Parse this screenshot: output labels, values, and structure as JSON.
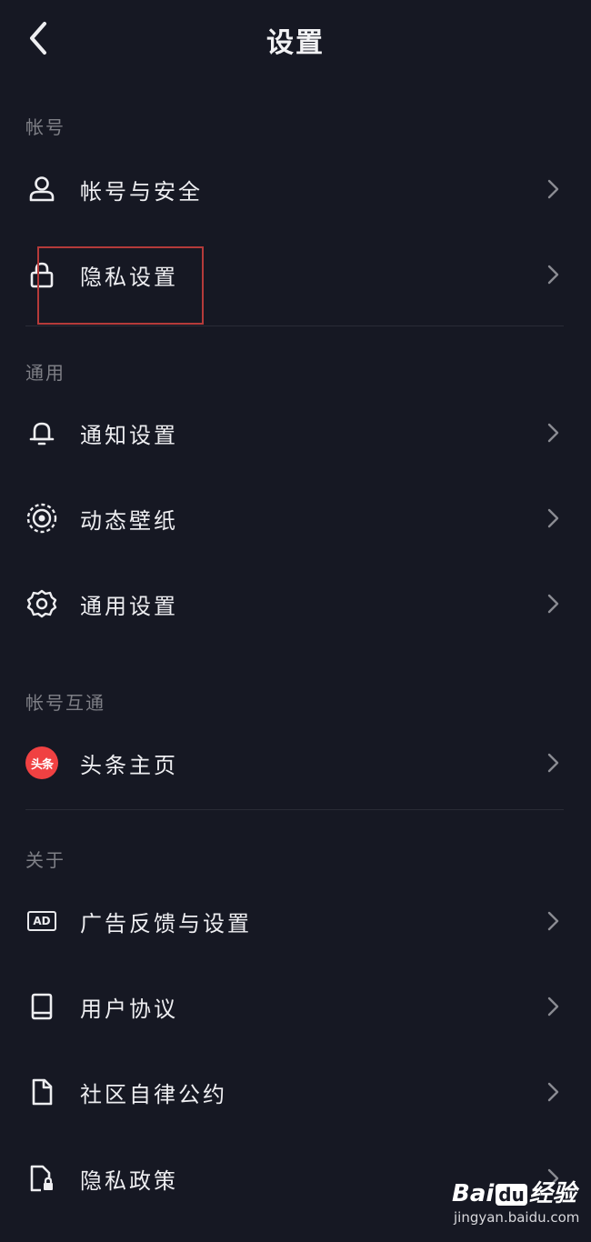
{
  "header": {
    "title": "设置"
  },
  "sections": {
    "account": "帐号",
    "general": "通用",
    "interop": "帐号互通",
    "about": "关于"
  },
  "items": {
    "account_security": "帐号与安全",
    "privacy_settings": "隐私设置",
    "notification_settings": "通知设置",
    "live_wallpaper": "动态壁纸",
    "general_settings": "通用设置",
    "toutiao_homepage": "头条主页",
    "ad_feedback": "广告反馈与设置",
    "user_agreement": "用户协议",
    "community_convention": "社区自律公约",
    "privacy_policy": "隐私政策"
  },
  "icons": {
    "toutiao_badge_text": "头条",
    "ad_badge_text": "AD"
  },
  "watermark": {
    "logo_left": "Bai",
    "logo_mid": "du",
    "logo_right": "经验",
    "url": "jingyan.baidu.com"
  },
  "colors": {
    "background": "#161823",
    "text": "#eeeef1",
    "section_text": "#7e7f86",
    "highlight_border": "#b53a3a",
    "toutiao_red": "#f04142"
  }
}
